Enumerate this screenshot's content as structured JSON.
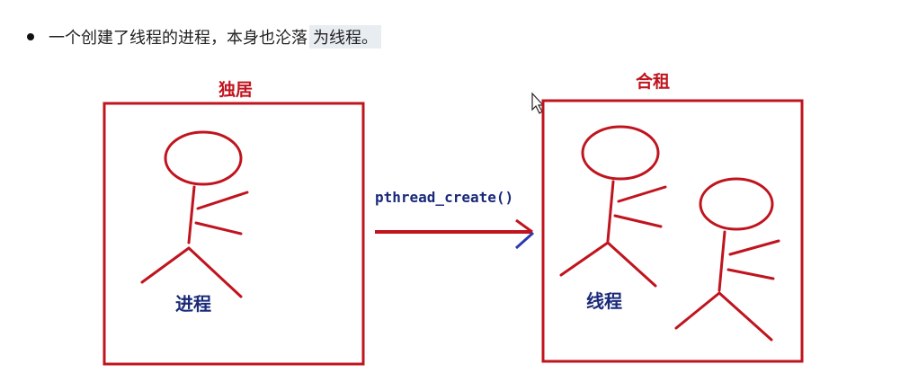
{
  "bullet": {
    "text": "一个创建了线程的进程，本身也沦落",
    "highlight": "为线程。"
  },
  "diagram": {
    "left_title": "独居",
    "left_label": "进程",
    "arrow_label": "pthread_create()",
    "right_title": "合租",
    "right_label": "线程",
    "colors": {
      "frame": "#c0141e",
      "text": "#1a2a7a",
      "arrow": "#c0141e"
    }
  }
}
